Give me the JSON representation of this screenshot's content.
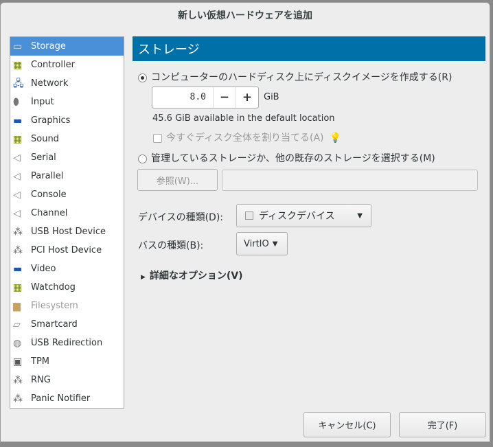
{
  "dialog": {
    "title": "新しい仮想ハードウェアを追加"
  },
  "sidebar": {
    "items": [
      {
        "label": "Storage",
        "icon": "storage-icon",
        "selected": true
      },
      {
        "label": "Controller",
        "icon": "controller-card-icon"
      },
      {
        "label": "Network",
        "icon": "network-icon"
      },
      {
        "label": "Input",
        "icon": "mouse-icon"
      },
      {
        "label": "Graphics",
        "icon": "monitor-icon"
      },
      {
        "label": "Sound",
        "icon": "sound-card-icon"
      },
      {
        "label": "Serial",
        "icon": "port-icon"
      },
      {
        "label": "Parallel",
        "icon": "port-icon"
      },
      {
        "label": "Console",
        "icon": "port-icon"
      },
      {
        "label": "Channel",
        "icon": "port-icon"
      },
      {
        "label": "USB Host Device",
        "icon": "usb-device-icon"
      },
      {
        "label": "PCI Host Device",
        "icon": "pci-device-icon"
      },
      {
        "label": "Video",
        "icon": "monitor-icon"
      },
      {
        "label": "Watchdog",
        "icon": "watchdog-card-icon"
      },
      {
        "label": "Filesystem",
        "icon": "folder-icon",
        "disabled": true
      },
      {
        "label": "Smartcard",
        "icon": "smartcard-icon"
      },
      {
        "label": "USB Redirection",
        "icon": "usb-redirection-icon"
      },
      {
        "label": "TPM",
        "icon": "chip-icon"
      },
      {
        "label": "RNG",
        "icon": "rng-icon"
      },
      {
        "label": "Panic Notifier",
        "icon": "panic-icon"
      }
    ]
  },
  "main": {
    "header": "ストレージ",
    "create_radio": "コンピューターのハードディスク上にディスクイメージを作成する(R)",
    "size_value": "8.0",
    "minus": "−",
    "plus": "+",
    "unit": "GiB",
    "available": "45.6 GiB available in the default location",
    "allocate_checkbox": "今すぐディスク全体を割り当てる(A)",
    "select_radio": "管理しているストレージか、他の既存のストレージを選択する(M)",
    "browse_button": "参照(W)...",
    "path_value": "",
    "device_type_label": "デバイスの種類(D):",
    "device_type_value": "ディスクデバイス",
    "bus_type_label": "バスの種類(B):",
    "bus_type_value": "VirtIO",
    "advanced": "詳細なオプション(V)"
  },
  "footer": {
    "cancel": "キャンセル(C)",
    "finish": "完了(F)"
  },
  "colors": {
    "header": "#0070a8",
    "selection": "#4a90d9"
  }
}
